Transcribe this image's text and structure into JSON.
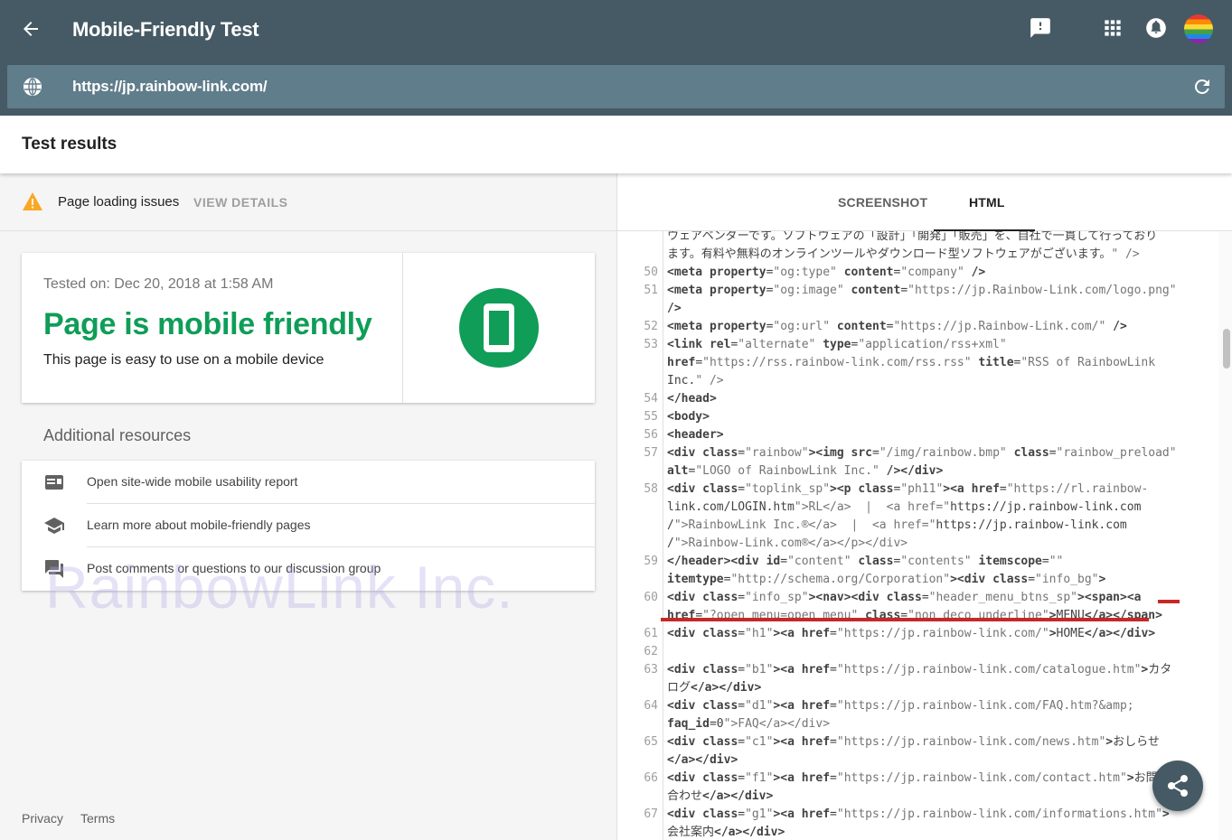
{
  "header": {
    "title": "Mobile-Friendly Test",
    "url": "https://jp.rainbow-link.com/"
  },
  "results": {
    "title": "Test results",
    "issues_text": "Page loading issues",
    "view_details": "VIEW DETAILS",
    "tested_on": "Tested on: Dec 20, 2018 at 1:58 AM",
    "verdict": "Page is mobile friendly",
    "verdict_sub": "This page is easy to use on a mobile device"
  },
  "resources": {
    "title": "Additional resources",
    "items": [
      {
        "label": "Open site-wide mobile usability report",
        "icon": "report-icon"
      },
      {
        "label": "Learn more about mobile-friendly pages",
        "icon": "school-icon"
      },
      {
        "label": "Post comments or questions to our discussion group",
        "icon": "forum-icon"
      }
    ]
  },
  "watermark": "RainbowLink Inc.",
  "footer": {
    "privacy": "Privacy",
    "terms": "Terms"
  },
  "tabs": {
    "screenshot": "SCREENSHOT",
    "html": "HTML"
  },
  "code_lines": [
    {
      "n": "",
      "html": "ウェアベンダーです。ソフトウェアの「設計」「開発」「販売」を、自社で一貫して行っており"
    },
    {
      "n": "",
      "html": "ます。有料や無料のオンラインツールやダウンロード型ソフトウェアがございます。\" />"
    },
    {
      "n": "50",
      "html": "<meta property=\"og:type\" content=\"company\" />"
    },
    {
      "n": "51",
      "html": "<meta property=\"og:image\" content=\"https://jp.Rainbow-Link.com/logo.png\""
    },
    {
      "n": "",
      "html": "/>"
    },
    {
      "n": "52",
      "html": "<meta property=\"og:url\" content=\"https://jp.Rainbow-Link.com/\" />"
    },
    {
      "n": "53",
      "html": "<link rel=\"alternate\" type=\"application/rss+xml\""
    },
    {
      "n": "",
      "html": "href=\"https://rss.rainbow-link.com/rss.rss\" title=\"RSS of RainbowLink"
    },
    {
      "n": "",
      "html": "Inc.\" />"
    },
    {
      "n": "54",
      "html": "</head>"
    },
    {
      "n": "55",
      "html": "<body>"
    },
    {
      "n": "56",
      "html": "<header>"
    },
    {
      "n": "57",
      "html": "<div class=\"rainbow\"><img src=\"/img/rainbow.bmp\" class=\"rainbow_preload\""
    },
    {
      "n": "",
      "html": "alt=\"LOGO of RainbowLink Inc.\" /></div>"
    },
    {
      "n": "58",
      "html": "<div class=\"toplink_sp\"><p class=\"ph11\"><a href=\"https://rl.rainbow-"
    },
    {
      "n": "",
      "html": "link.com/LOGIN.htm\">RL</a>  |  <a href=\"https://jp.rainbow-link.com"
    },
    {
      "n": "",
      "html": "/\">RainbowLink Inc.®</a>  |  <a href=\"https://jp.rainbow-link.com"
    },
    {
      "n": "",
      "html": "/\">Rainbow-Link.com®</a></p></div>"
    },
    {
      "n": "59",
      "html": "</header><div id=\"content\" class=\"contents\" itemscope=\"\""
    },
    {
      "n": "",
      "html": "itemtype=\"http://schema.org/Corporation\"><div class=\"info_bg\">"
    },
    {
      "n": "60",
      "html": "<div class=\"info_sp\"><nav><div class=\"header_menu_btns_sp\"><span><a"
    },
    {
      "n": "",
      "html": "href=\"?open_menu=open_menu\" class=\"non_deco underline\">MENU</a></span>"
    },
    {
      "n": "61",
      "html": "<div class=\"h1\"><a href=\"https://jp.rainbow-link.com/\">HOME</a></div>"
    },
    {
      "n": "62",
      "html": ""
    },
    {
      "n": "63",
      "html": "<div class=\"b1\"><a href=\"https://jp.rainbow-link.com/catalogue.htm\">カタ"
    },
    {
      "n": "",
      "html": "ログ</a></div>"
    },
    {
      "n": "64",
      "html": "<div class=\"d1\"><a href=\"https://jp.rainbow-link.com/FAQ.htm?&amp;"
    },
    {
      "n": "",
      "html": "faq_id=0\">FAQ</a></div>"
    },
    {
      "n": "65",
      "html": "<div class=\"c1\"><a href=\"https://jp.rainbow-link.com/news.htm\">おしらせ"
    },
    {
      "n": "",
      "html": "</a></div>"
    },
    {
      "n": "66",
      "html": "<div class=\"f1\"><a href=\"https://jp.rainbow-link.com/contact.htm\">お問い"
    },
    {
      "n": "",
      "html": "合わせ</a></div>"
    },
    {
      "n": "67",
      "html": "<div class=\"g1\"><a href=\"https://jp.rainbow-link.com/informations.htm\">"
    },
    {
      "n": "",
      "html": "会社案内</a></div>"
    }
  ],
  "colors": {
    "topbar": "#455a64",
    "urlbar": "#607d8b",
    "success": "#0f9d58",
    "warning": "#f9a825",
    "highlight": "#c62828"
  }
}
